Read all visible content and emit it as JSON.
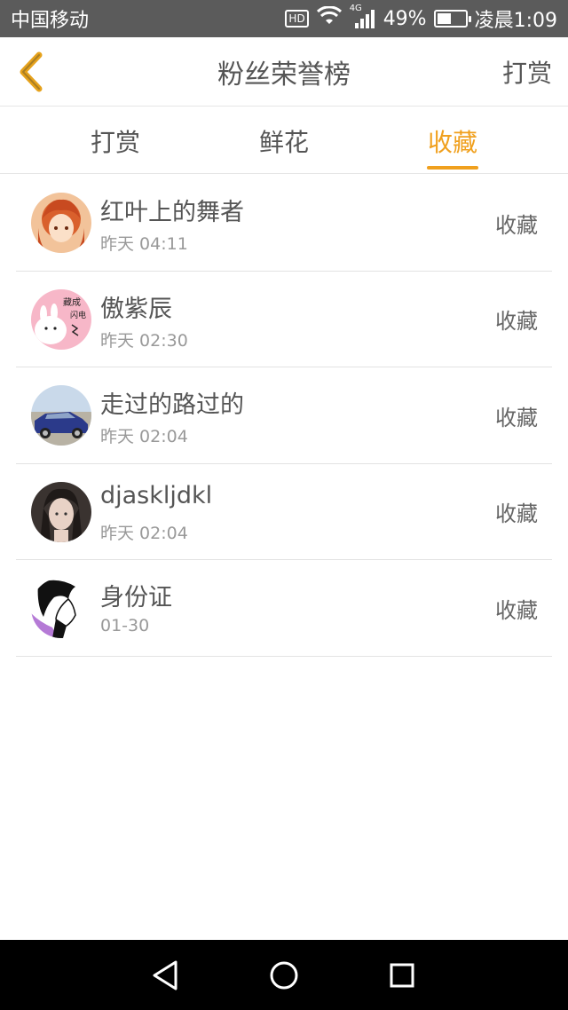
{
  "status_bar": {
    "carrier": "中国移动",
    "hd": "HD",
    "network": "4G",
    "battery": "49%",
    "battery_level": 0.49,
    "time": "凌晨1:09"
  },
  "header": {
    "title": "粉丝荣誉榜",
    "action": "打赏",
    "accent_color": "#f0a01e"
  },
  "tabs": [
    {
      "label": "打赏",
      "active": false
    },
    {
      "label": "鲜花",
      "active": false
    },
    {
      "label": "收藏",
      "active": true
    }
  ],
  "list": [
    {
      "name": "红叶上的舞者",
      "time": "昨天 04:11",
      "action": "收藏",
      "avatar": "anime-girl-avatar"
    },
    {
      "name": "傲紫辰",
      "time": "昨天 02:30",
      "action": "收藏",
      "avatar": "cartoon-rabbit-avatar"
    },
    {
      "name": "走过的路过的",
      "time": "昨天 02:04",
      "action": "收藏",
      "avatar": "car-avatar"
    },
    {
      "name": "djaskljdkl",
      "time": "昨天 02:04",
      "action": "收藏",
      "avatar": "photo-girl-avatar"
    },
    {
      "name": "身份证",
      "time": "01-30",
      "action": "收藏",
      "avatar": "sketch-portrait-avatar"
    }
  ],
  "nav_bar": {
    "icons": [
      "back-triangle-icon",
      "home-circle-icon",
      "recents-square-icon"
    ]
  }
}
